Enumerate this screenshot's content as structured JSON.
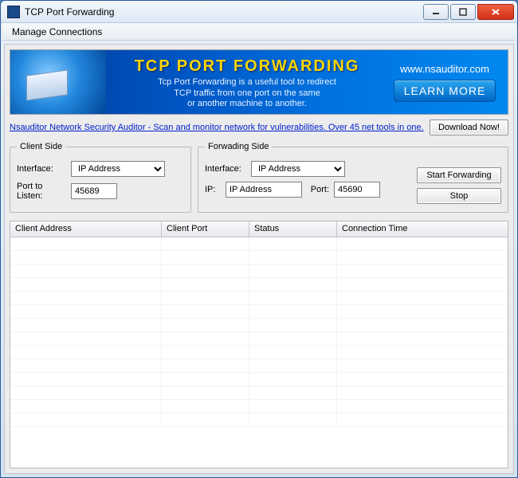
{
  "window": {
    "title": "TCP Port Forwarding"
  },
  "menu": {
    "manage_connections": "Manage Connections"
  },
  "banner": {
    "title": "TCP PORT FORWARDING",
    "desc_line1": "Tcp Port Forwarding is a useful tool to redirect",
    "desc_line2": "TCP  traffic from one port on the same",
    "desc_line3": "or another machine to another.",
    "url": "www.nsauditor.com",
    "learn_more": "LEARN MORE"
  },
  "promo": {
    "link_text": "Nsauditor Network Security Auditor - Scan and monitor network for vulnerabilities. Over 45 net tools in one.",
    "download_btn": "Download Now!"
  },
  "client_side": {
    "legend": "Client Side",
    "interface_label": "Interface:",
    "interface_value": "IP Address",
    "port_label": "Port to Listen:",
    "port_value": "45689"
  },
  "forwarding_side": {
    "legend": "Forwading Side",
    "interface_label": "Interface:",
    "interface_value": "IP Address",
    "ip_label": "IP:",
    "ip_value": "IP Address",
    "port_label": "Port:",
    "port_value": "45690",
    "start_btn": "Start Forwarding",
    "stop_btn": "Stop"
  },
  "table": {
    "headers": {
      "client_address": "Client Address",
      "client_port": "Client Port",
      "status": "Status",
      "connection_time": "Connection Time"
    }
  }
}
